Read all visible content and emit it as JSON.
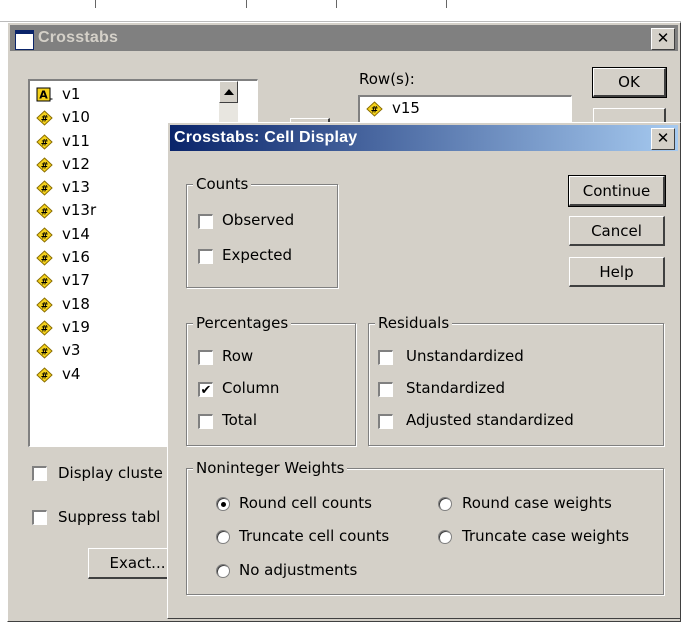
{
  "crosstabs": {
    "title": "Crosstabs",
    "variables": [
      "v1",
      "v10",
      "v11",
      "v12",
      "v13",
      "v13r",
      "v14",
      "v16",
      "v17",
      "v18",
      "v19",
      "v3",
      "v4"
    ],
    "rows_label": "Row(s):",
    "rows_item": "v15",
    "ok_label": "OK",
    "display_clustered_label": "Display cluste",
    "suppress_tables_label": "Suppress tabl",
    "exact_label": "Exact..."
  },
  "cell_display": {
    "title": "Crosstabs: Cell Display",
    "continue_label": "Continue",
    "cancel_label": "Cancel",
    "help_label": "Help",
    "counts": {
      "title": "Counts",
      "observed": {
        "label": "Observed",
        "checked": false
      },
      "expected": {
        "label": "Expected",
        "checked": false
      }
    },
    "percentages": {
      "title": "Percentages",
      "row": {
        "label": "Row",
        "checked": false
      },
      "column": {
        "label": "Column",
        "checked": true
      },
      "total": {
        "label": "Total",
        "checked": false
      }
    },
    "residuals": {
      "title": "Residuals",
      "unstandardized": {
        "label": "Unstandardized",
        "checked": false
      },
      "standardized": {
        "label": "Standardized",
        "checked": false
      },
      "adjusted": {
        "label": "Adjusted standardized",
        "checked": false
      }
    },
    "weights": {
      "title": "Noninteger Weights",
      "round_cell": {
        "label": "Round cell counts",
        "selected": true
      },
      "round_case": {
        "label": "Round case weights",
        "selected": false
      },
      "truncate_cell": {
        "label": "Truncate cell counts",
        "selected": false
      },
      "truncate_case": {
        "label": "Truncate case weights",
        "selected": false
      },
      "no_adjust": {
        "label": "No adjustments",
        "selected": false
      }
    }
  },
  "colors": {
    "active_title_start": "#0a246a",
    "active_title_end": "#a6caf0",
    "inactive_title": "#808080",
    "face": "#d4d0c8",
    "var_icon_yellow": "#f5d21b"
  }
}
